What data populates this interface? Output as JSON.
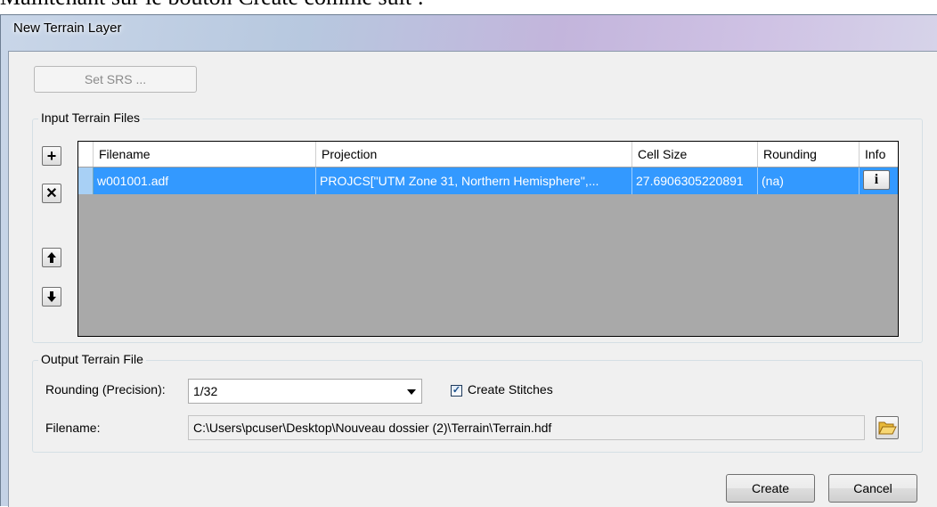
{
  "document": {
    "text": "Maintenant sur le bouton Create comme suit :"
  },
  "window": {
    "title": "New Terrain Layer"
  },
  "set_srs_label": "Set SRS ...",
  "input_group": {
    "label": "Input Terrain Files",
    "buttons": {
      "add": "+",
      "remove": "✕",
      "up": "🠅",
      "down": "🠇"
    },
    "columns": [
      "Filename",
      "Projection",
      "Cell Size",
      "Rounding",
      "Info"
    ],
    "rows": [
      {
        "filename": "w001001.adf",
        "projection": "PROJCS[\"UTM Zone 31, Northern Hemisphere\",...",
        "cell_size": "27.6906305220891",
        "rounding": "(na)",
        "info": "i"
      }
    ]
  },
  "output_group": {
    "label": "Output Terrain File",
    "rounding_label": "Rounding (Precision):",
    "rounding_value": "1/32",
    "stitches_label": "Create Stitches",
    "stitches_checked": true,
    "filename_label": "Filename:",
    "filename_value": "C:\\Users\\pcuser\\Desktop\\Nouveau dossier (2)\\Terrain\\Terrain.hdf"
  },
  "footer": {
    "create_label": "Create",
    "cancel_label": "Cancel"
  },
  "colors": {
    "selection": "#3399ff",
    "grid_background": "#a9a9a9",
    "dialog": "#f0f0f0"
  }
}
